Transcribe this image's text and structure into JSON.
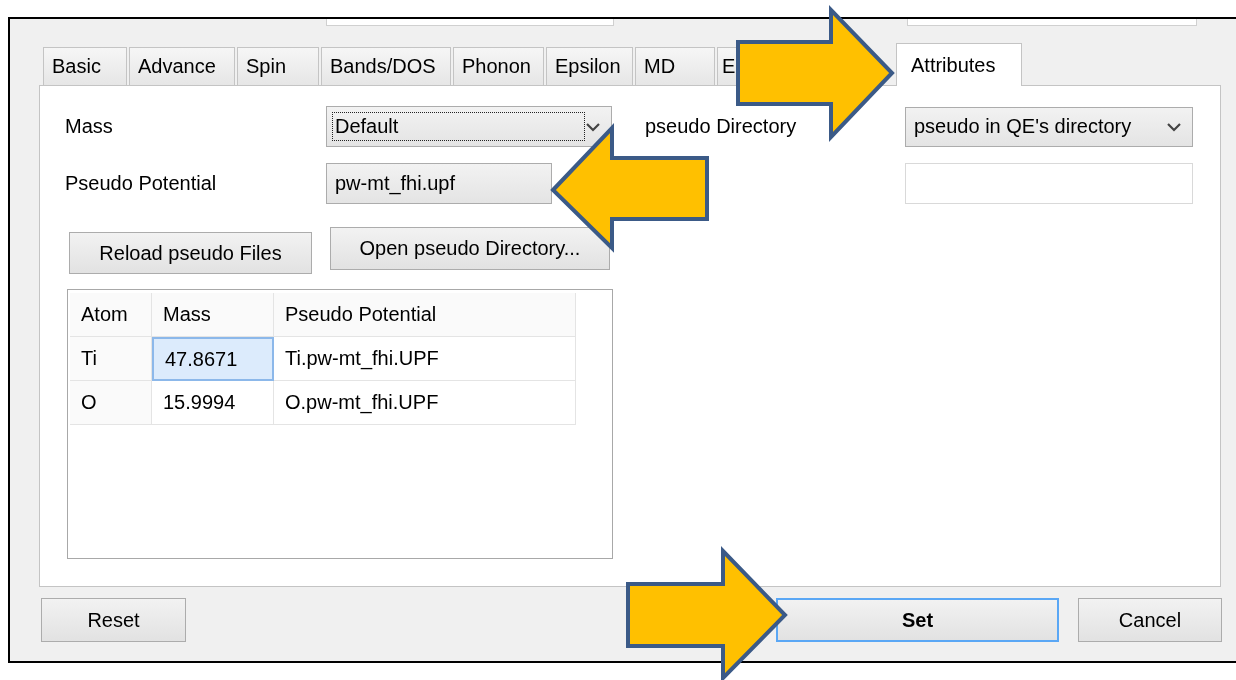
{
  "top_fields": [
    {
      "kind": "field"
    },
    {
      "kind": "field"
    }
  ],
  "tabs": [
    {
      "label": "Basic",
      "selected": false
    },
    {
      "label": "Advance",
      "selected": false
    },
    {
      "label": "Spin",
      "selected": false
    },
    {
      "label": "Bands/DOS",
      "selected": false
    },
    {
      "label": "Phonon",
      "selected": false
    },
    {
      "label": "Epsilon",
      "selected": false
    },
    {
      "label": "MD",
      "selected": false
    },
    {
      "label": "E",
      "selected": false
    },
    {
      "label": "Attributes",
      "selected": true
    }
  ],
  "mass": {
    "label": "Mass",
    "value": "Default",
    "focused": true,
    "chevron": true
  },
  "pseudo_potential": {
    "label": "Pseudo Potential",
    "value": "pw-mt_fhi.upf",
    "focused": false,
    "chevron": false
  },
  "pseudo_directory": {
    "label": "pseudo Directory",
    "value": "pseudo in QE's directory",
    "focused": false,
    "chevron": true
  },
  "buttons": [
    "Reload pseudo Files",
    "Open pseudo Directory..."
  ],
  "table": {
    "columns": [
      "Atom",
      "Mass",
      "Pseudo Potential"
    ],
    "rows": [
      {
        "cells": [
          {
            "text": "Ti",
            "selected": false
          },
          {
            "text": "47.8671",
            "selected": true
          },
          {
            "text": "Ti.pw-mt_fhi.UPF",
            "selected": false
          }
        ]
      },
      {
        "cells": [
          {
            "text": "O",
            "selected": false
          },
          {
            "text": "15.9994",
            "selected": false
          },
          {
            "text": "O.pw-mt_fhi.UPF",
            "selected": false
          }
        ]
      }
    ]
  },
  "dialog_buttons": [
    {
      "label": "Reset",
      "default": false
    },
    {
      "label": "Set",
      "default": true
    },
    {
      "label": "Cancel",
      "default": false
    }
  ]
}
